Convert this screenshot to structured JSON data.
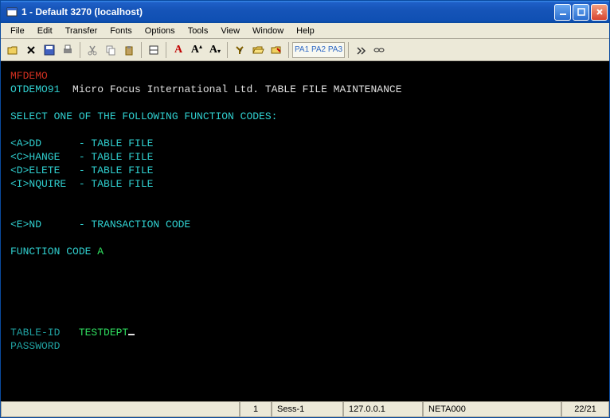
{
  "titlebar": {
    "text": "1 - Default 3270 (localhost)"
  },
  "menubar": {
    "items": [
      "File",
      "Edit",
      "Transfer",
      "Fonts",
      "Options",
      "Tools",
      "View",
      "Window",
      "Help"
    ]
  },
  "toolbar": {
    "pa_buttons": "PA1 PA2 PA3"
  },
  "terminal": {
    "header_app": "MFDEMO",
    "header_id": "OTDEMO91",
    "header_company": "  Micro Focus International Ltd. TABLE FILE MAINTENANCE",
    "prompt": "SELECT ONE OF THE FOLLOWING FUNCTION CODES:",
    "opt_add": "<A>DD      - TABLE FILE",
    "opt_change": "<C>HANGE   - TABLE FILE",
    "opt_delete": "<D>ELETE   - TABLE FILE",
    "opt_inquire": "<I>NQUIRE  - TABLE FILE",
    "opt_end": "<E>ND      - TRANSACTION CODE",
    "func_label": "FUNCTION CODE ",
    "func_value": "A",
    "table_label": "TABLE-ID   ",
    "table_value": "TESTDEPT",
    "password_label": "PASSWORD"
  },
  "statusbar": {
    "session_num": "1",
    "session_name": "Sess-1",
    "host": "127.0.0.1",
    "netid": "NETA000",
    "cursor_pos": "22/21"
  }
}
